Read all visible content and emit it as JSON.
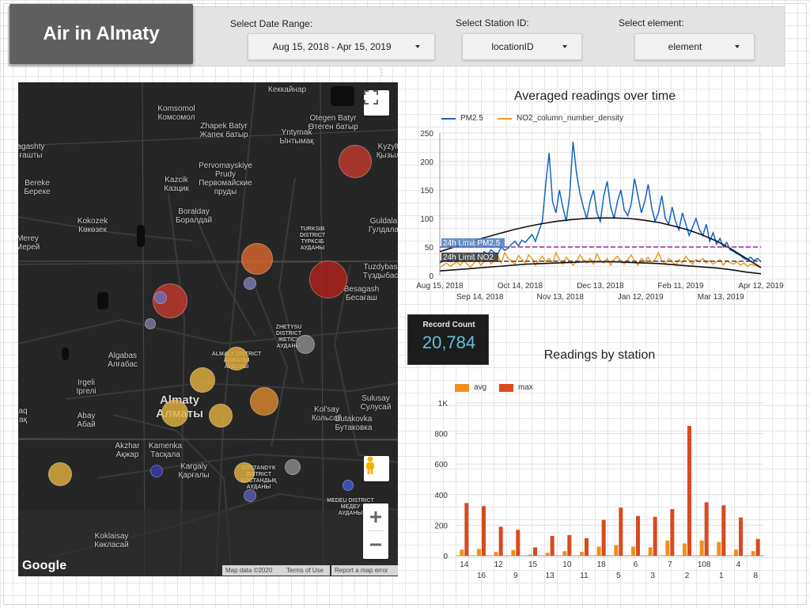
{
  "header": {
    "title": "Air in Almaty",
    "controls": [
      {
        "label": "Select Date Range:",
        "value": "Aug 15, 2018 - Apr 15, 2019"
      },
      {
        "label": "Select Station ID:",
        "value": "locationID"
      },
      {
        "label": "Select element:",
        "value": "element"
      }
    ]
  },
  "map": {
    "labels": [
      {
        "text": "Кеккайнар",
        "cls": ""
      },
      {
        "text": "Komsomol\nКомсомол",
        "cls": ""
      },
      {
        "text": "Otegen Batyr\nӨтеген батыр",
        "cls": ""
      },
      {
        "text": "Zhapek Batyr\nЖапек батыр",
        "cls": ""
      },
      {
        "text": "Yntymak\nЫнтымақ",
        "cls": ""
      },
      {
        "text": "Kyzylt\nҚызыл",
        "cls": ""
      },
      {
        "text": "agashty\nғашты",
        "cls": ""
      },
      {
        "text": "Pervomayskiye\nPrudy\nПервомайские\nпруды",
        "cls": ""
      },
      {
        "text": "Bereke\nБереке",
        "cls": ""
      },
      {
        "text": "Kazcik\nКазцик",
        "cls": ""
      },
      {
        "text": "Boralday\nБоралдай",
        "cls": ""
      },
      {
        "text": "Kokozek\nКөкөзек",
        "cls": ""
      },
      {
        "text": "TURKSIB\nDISTRICT\nТҮРКСІБ\nАУДАНЫ",
        "cls": "district"
      },
      {
        "text": "Guldala\nГулдала",
        "cls": ""
      },
      {
        "text": "Merey\nМерей",
        "cls": ""
      },
      {
        "text": "Tuzdybas\nТүздыбас",
        "cls": ""
      },
      {
        "text": "Besagash\nБесағаш",
        "cls": ""
      },
      {
        "text": "ZHETYSU\nDISTRICT\nЖЕТІСУ\nАУДАНЫ",
        "cls": "district"
      },
      {
        "text": "Algabas\nАлғабас",
        "cls": ""
      },
      {
        "text": "ALMALY DISTRICT\nАЛМАЛЫ\nАУДАНЫ",
        "cls": "district"
      },
      {
        "text": "Irgeli\nІргелі",
        "cls": ""
      },
      {
        "text": "Almaty\nАлматы",
        "cls": "city"
      },
      {
        "text": "Sulusay\nСулусай",
        "cls": ""
      },
      {
        "text": "aq\nақ",
        "cls": ""
      },
      {
        "text": "Abay\nАбай",
        "cls": ""
      },
      {
        "text": "Kol'say\nКольсай",
        "cls": ""
      },
      {
        "text": "Akzhar\nАқжар",
        "cls": ""
      },
      {
        "text": "Kamenka\nТасқала",
        "cls": ""
      },
      {
        "text": "Butakovka\nБутаковка",
        "cls": ""
      },
      {
        "text": "Kargaly\nҚарғалы",
        "cls": ""
      },
      {
        "text": "BOSTANDYK\nDISTRICT\nБОСТАНДЫҚ\nАУДАНЫ",
        "cls": "district"
      },
      {
        "text": "MEDEU DISTRICT\nМЕДЕУ\nАУДАНЫ",
        "cls": "district"
      },
      {
        "text": "Koklaisay\nКөкласай",
        "cls": ""
      }
    ],
    "markers": [
      {
        "color": "#c0392b"
      },
      {
        "color": "#d9662e"
      },
      {
        "color": "#b0201a"
      },
      {
        "color": "#c0392b"
      },
      {
        "color": "#6a6fb8"
      },
      {
        "color": "#7a7ab0"
      },
      {
        "color": "#e0ac3a"
      },
      {
        "color": "#e0b040"
      },
      {
        "color": "#d9882e"
      },
      {
        "color": "#e0b040"
      },
      {
        "color": "#e0b040"
      },
      {
        "color": "#8a8a8a"
      },
      {
        "color": "#7a7a9a"
      },
      {
        "color": "#e0b040"
      },
      {
        "color": "#3a3ab0"
      },
      {
        "color": "#5a5ab0"
      },
      {
        "color": "#8a8a8a"
      },
      {
        "color": "#3a5ad0"
      },
      {
        "color": "#e0b040"
      }
    ],
    "google_logo": "Google",
    "attribution": [
      "Map data ©2020",
      "Terms of Use",
      "Report a map error"
    ],
    "icons": [
      "fullscreen-icon",
      "pegman-icon",
      "zoom-in-icon",
      "zoom-out-icon"
    ]
  },
  "record_count": {
    "label": "Record Count",
    "value": "20,784"
  },
  "chart_data": [
    {
      "type": "line",
      "title": "Averaged readings over time",
      "series": [
        {
          "name": "PM2.5",
          "color": "#1565c0"
        },
        {
          "name": "NO2_column_number_density",
          "color": "#f09a20"
        }
      ],
      "ylim": [
        0,
        250
      ],
      "yticks": [
        "250",
        "200",
        "150",
        "100",
        "50",
        "0"
      ],
      "xticks_top": [
        "Aug 15, 2018",
        "Oct 14, 2018",
        "Dec 13, 2018",
        "Feb 11, 2019",
        "Apr 12, 2019"
      ],
      "xticks_bottom": [
        "Sep 14, 2018",
        "Nov 13, 2018",
        "Jan 12, 2019",
        "Mar 13, 2019"
      ],
      "reference_lines": [
        {
          "label": "24h Limit PM2.5",
          "value": 50,
          "color": "#a020a0"
        },
        {
          "label": "24h Limit NO2",
          "value": 25,
          "color": "#444444"
        }
      ],
      "pm25_values": [
        22,
        25,
        28,
        24,
        30,
        26,
        32,
        28,
        35,
        30,
        33,
        38,
        30,
        42,
        36,
        45,
        40,
        38,
        50,
        44,
        48,
        55,
        60,
        52,
        62,
        58,
        65,
        72,
        60,
        78,
        95,
        160,
        215,
        130,
        110,
        150,
        120,
        95,
        140,
        235,
        180,
        145,
        120,
        100,
        130,
        150,
        110,
        95,
        140,
        165,
        120,
        100,
        130,
        150,
        115,
        105,
        125,
        170,
        140,
        110,
        130,
        160,
        120,
        95,
        110,
        140,
        100,
        90,
        120,
        95,
        80,
        110,
        90,
        70,
        85,
        100,
        80,
        70,
        90,
        60,
        75,
        55,
        65,
        50,
        58,
        45,
        42,
        38,
        35,
        30,
        28,
        32,
        26,
        30,
        24
      ],
      "no2_values": [
        14,
        18,
        22,
        16,
        20,
        24,
        18,
        26,
        20,
        15,
        22,
        28,
        18,
        24,
        30,
        20,
        26,
        34,
        22,
        40,
        30,
        25,
        20,
        35,
        28,
        22,
        36,
        30,
        18,
        26,
        34,
        24,
        30,
        22,
        40,
        28,
        20,
        32,
        26,
        18,
        24,
        36,
        28,
        22,
        30,
        20,
        38,
        26,
        22,
        30,
        18,
        28,
        34,
        24,
        20,
        28,
        36,
        26,
        18,
        30,
        24,
        32,
        22,
        28,
        40,
        26,
        20,
        30,
        24,
        18,
        28,
        22,
        34,
        26,
        20,
        28,
        24,
        30,
        22,
        26,
        20,
        24,
        28,
        18,
        26,
        22,
        20,
        24,
        18,
        22,
        16,
        20,
        18,
        16,
        14
      ],
      "trend_pm25": [
        42,
        50,
        58,
        66,
        73,
        80,
        86,
        91,
        95,
        98,
        100,
        101,
        101,
        100,
        97,
        93,
        87,
        80,
        71,
        60,
        46,
        30,
        14
      ],
      "trend_no2": [
        8,
        10,
        12,
        14,
        16,
        18,
        20,
        21,
        22,
        23,
        24,
        24,
        24,
        23,
        22,
        21,
        19,
        17,
        15,
        13,
        10,
        6,
        3
      ]
    },
    {
      "type": "bar",
      "title": "Readings by station",
      "series": [
        {
          "name": "avg",
          "color": "#f0901a"
        },
        {
          "name": "max",
          "color": "#d84a20"
        }
      ],
      "ylim": [
        0,
        1000
      ],
      "yticks": [
        "1K",
        "800",
        "600",
        "400",
        "200",
        "0"
      ],
      "categories": [
        "14",
        "16",
        "12",
        "9",
        "15",
        "13",
        "10",
        "11",
        "18",
        "5",
        "6",
        "3",
        "7",
        "2",
        "108",
        "1",
        "4",
        "8"
      ],
      "avg_values": [
        40,
        45,
        25,
        38,
        8,
        20,
        30,
        25,
        60,
        70,
        60,
        55,
        100,
        80,
        100,
        90,
        40,
        30
      ],
      "max_values": [
        345,
        325,
        190,
        170,
        55,
        130,
        135,
        115,
        235,
        315,
        260,
        255,
        305,
        850,
        350,
        330,
        250,
        110
      ]
    }
  ]
}
